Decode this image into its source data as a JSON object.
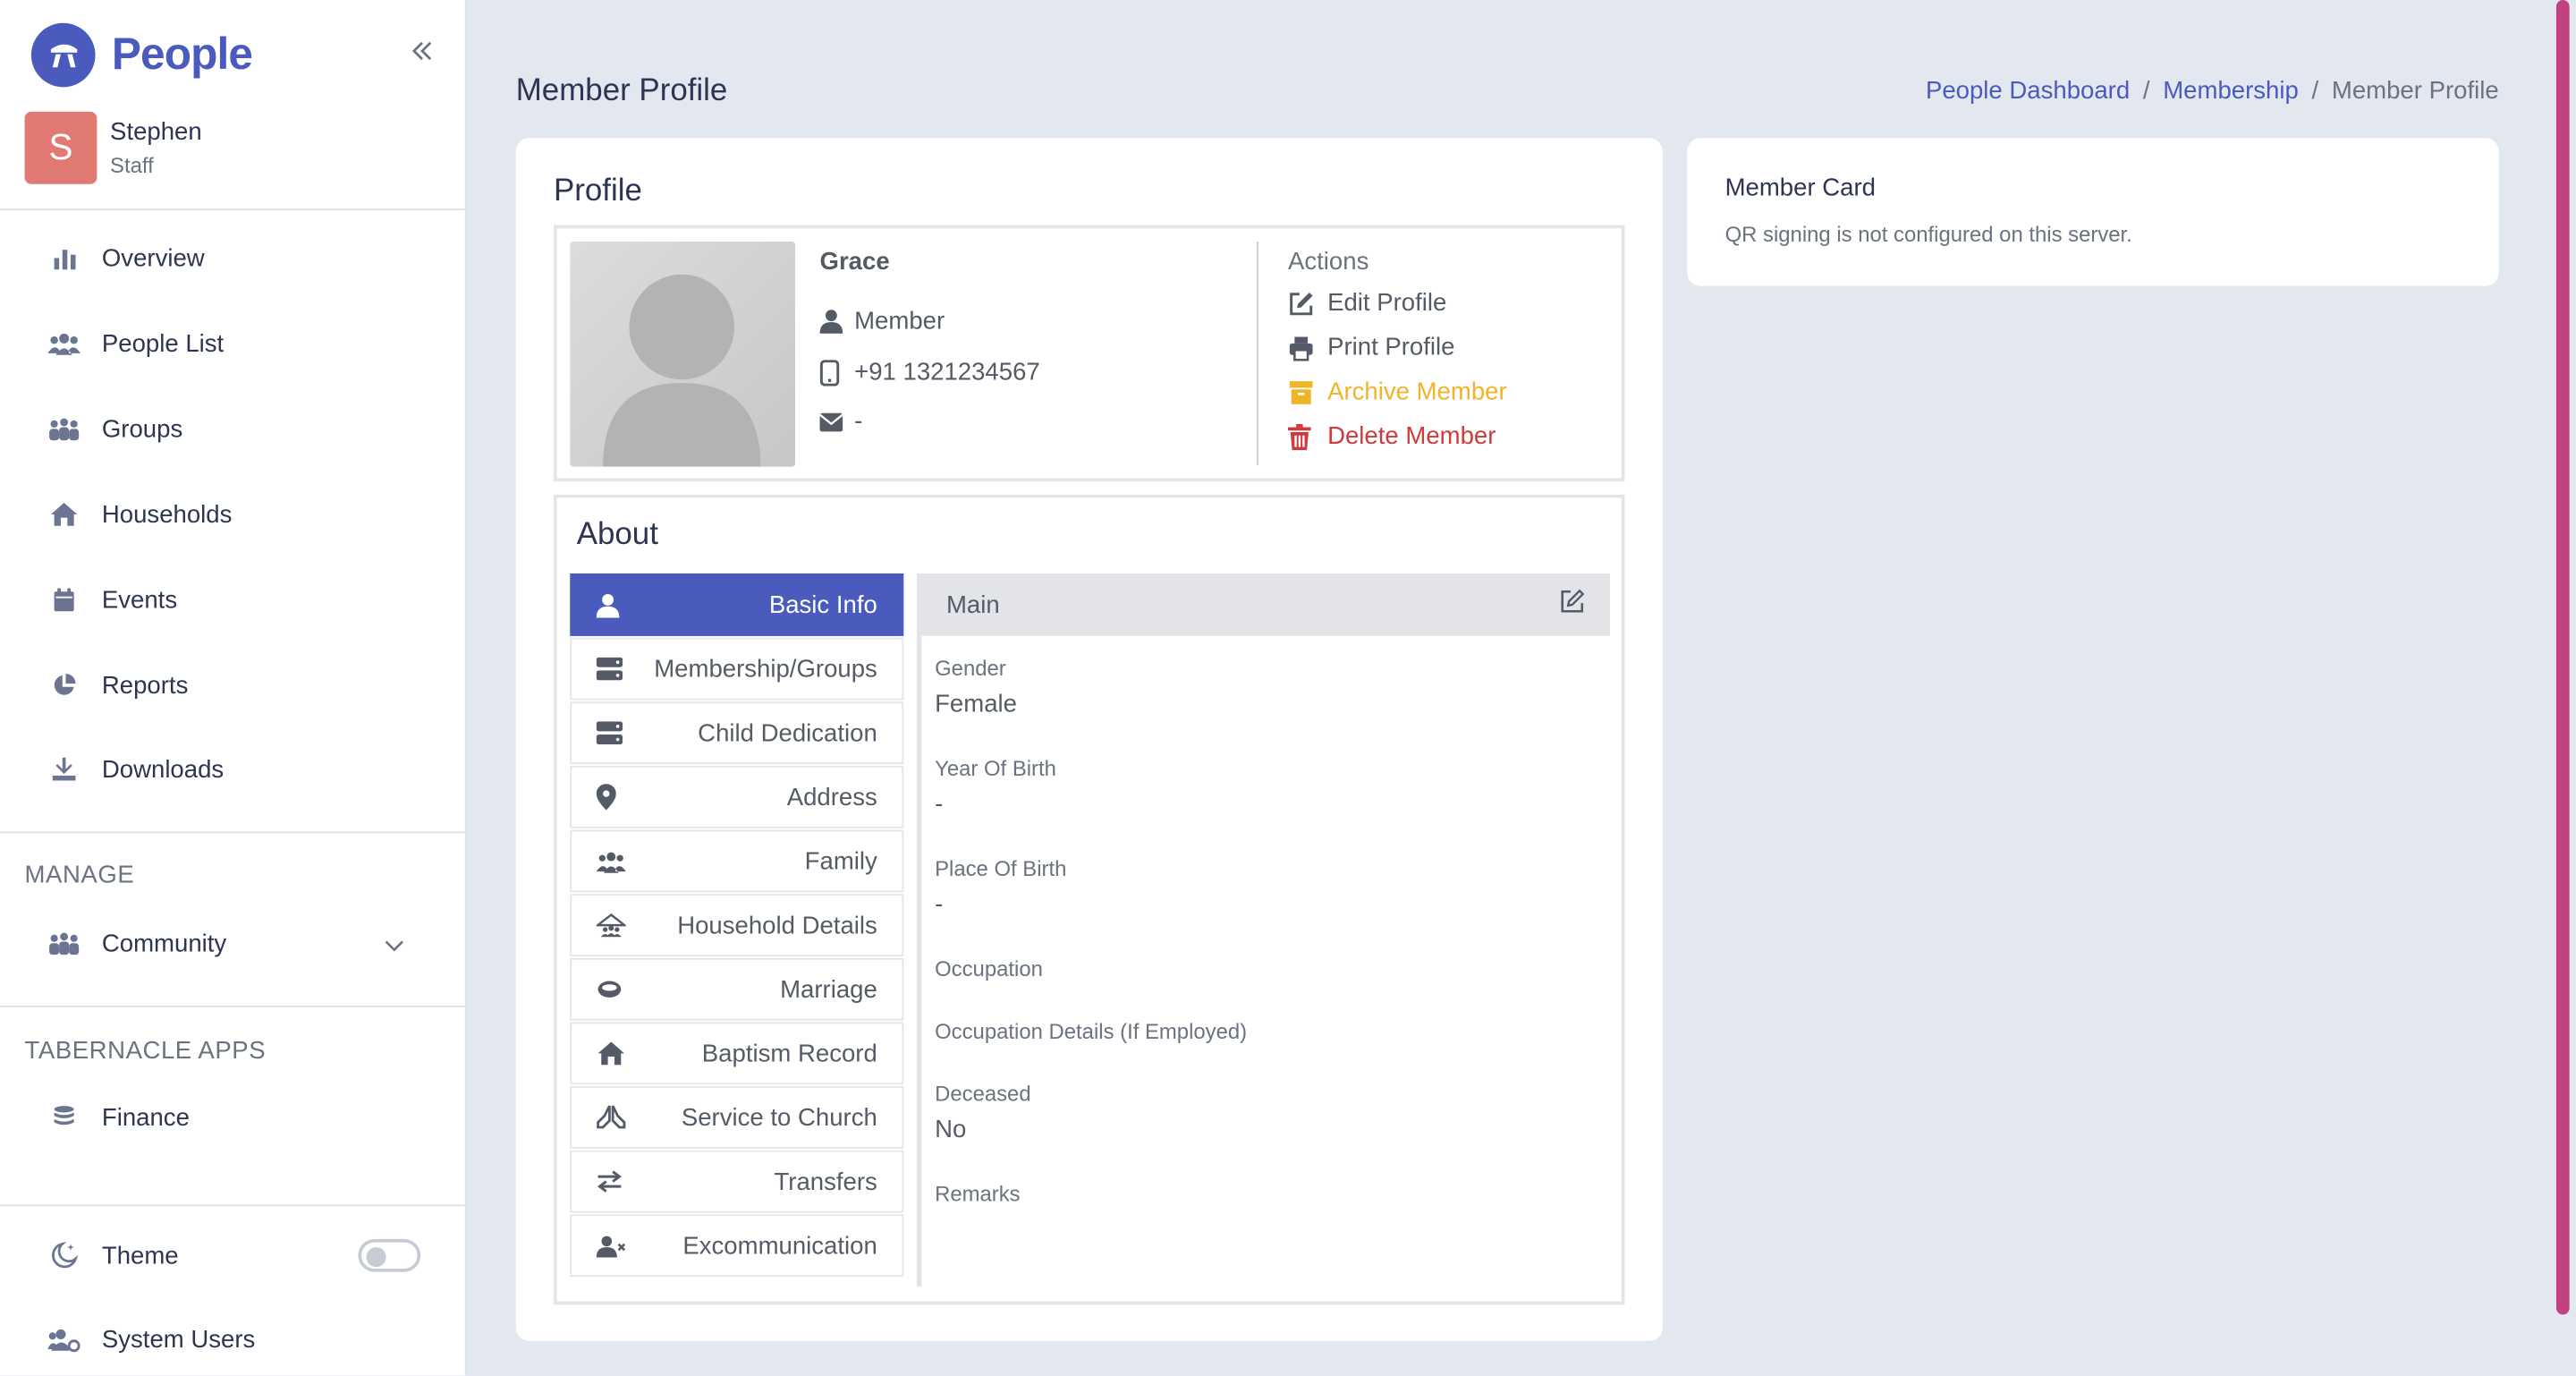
{
  "app": {
    "name": "People"
  },
  "user": {
    "initial": "S",
    "name": "Stephen",
    "role": "Staff"
  },
  "sidebar": {
    "items": [
      {
        "label": "Overview",
        "icon": "bar-chart-icon"
      },
      {
        "label": "People List",
        "icon": "users-icon"
      },
      {
        "label": "Groups",
        "icon": "group-icon"
      },
      {
        "label": "Households",
        "icon": "home-icon"
      },
      {
        "label": "Events",
        "icon": "calendar-icon"
      },
      {
        "label": "Reports",
        "icon": "pie-chart-icon"
      },
      {
        "label": "Downloads",
        "icon": "download-icon"
      }
    ],
    "manage_title": "MANAGE",
    "community_label": "Community",
    "apps_title": "TABERNACLE APPS",
    "finance_label": "Finance",
    "theme_label": "Theme",
    "theme_toggle_on": false,
    "system_users_label": "System Users"
  },
  "header": {
    "title": "Member Profile",
    "breadcrumb": [
      "People Dashboard",
      "Membership",
      "Member Profile"
    ]
  },
  "profile": {
    "heading": "Profile",
    "name": "Grace",
    "member_type": "Member",
    "phone": "+91 1321234567",
    "email": "-",
    "actions_title": "Actions",
    "actions": {
      "edit": "Edit Profile",
      "print": "Print Profile",
      "archive": "Archive Member",
      "delete": "Delete Member"
    },
    "colors": {
      "archive": "#f0b429",
      "delete": "#d03a3a",
      "accent": "#4a5bbd"
    }
  },
  "about": {
    "heading": "About",
    "tabs": [
      {
        "label": "Basic Info",
        "icon": "user-icon",
        "active": true
      },
      {
        "label": "Membership/Groups",
        "icon": "server-icon"
      },
      {
        "label": "Child Dedication",
        "icon": "server-icon"
      },
      {
        "label": "Address",
        "icon": "map-pin-icon"
      },
      {
        "label": "Family",
        "icon": "family-icon"
      },
      {
        "label": "Household Details",
        "icon": "household-icon"
      },
      {
        "label": "Marriage",
        "icon": "ring-icon"
      },
      {
        "label": "Baptism Record",
        "icon": "church-icon"
      },
      {
        "label": "Service to Church",
        "icon": "praying-hands-icon"
      },
      {
        "label": "Transfers",
        "icon": "transfer-icon"
      },
      {
        "label": "Excommunication",
        "icon": "user-remove-icon"
      }
    ],
    "section_title": "Main",
    "fields": [
      {
        "label": "Gender",
        "value": "Female"
      },
      {
        "label": "Year Of Birth",
        "value": "-"
      },
      {
        "label": "Place Of Birth",
        "value": "-"
      },
      {
        "label": "Occupation",
        "value": ""
      },
      {
        "label": "Occupation Details (If Employed)",
        "value": ""
      },
      {
        "label": "Deceased",
        "value": "No"
      },
      {
        "label": "Remarks",
        "value": ""
      }
    ]
  },
  "member_card": {
    "title": "Member Card",
    "message": "QR signing is not configured on this server."
  }
}
